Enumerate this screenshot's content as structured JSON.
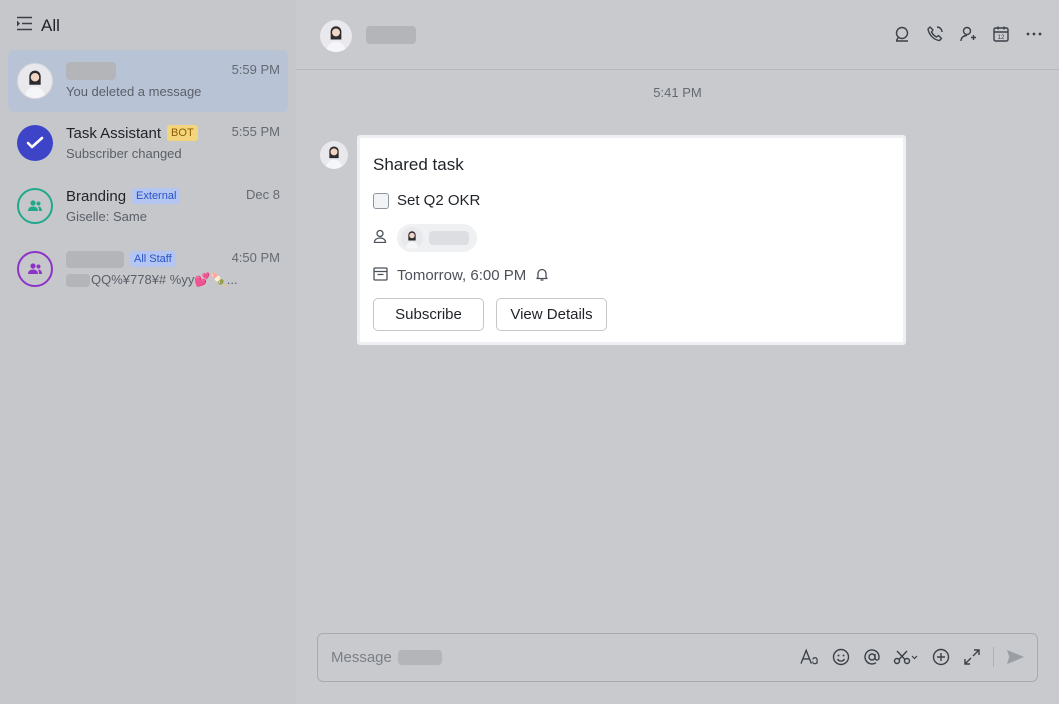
{
  "sidebar": {
    "title": "All",
    "chats": [
      {
        "name": "",
        "time": "5:59 PM",
        "preview": "You deleted a message",
        "tag": "",
        "active": true
      },
      {
        "name": "Task Assistant",
        "time": "5:55 PM",
        "preview": "Subscriber changed",
        "tag": "BOT"
      },
      {
        "name": "Branding",
        "time": "Dec 8",
        "preview": "Giselle: Same",
        "tag": "External"
      },
      {
        "name": "",
        "time": "4:50 PM",
        "preview": "QQ%¥778¥# %yy💕🍡...",
        "tag": "All Staff"
      }
    ]
  },
  "chat": {
    "header_name": "",
    "timestamp": "5:41 PM",
    "card": {
      "title": "Shared task",
      "task": "Set Q2 OKR",
      "due": "Tomorrow, 6:00 PM",
      "subscribe_label": "Subscribe",
      "view_label": "View Details"
    },
    "composer": {
      "placeholder": "Message"
    }
  },
  "colors": {
    "accent_blue": "#3d44c8",
    "group_green": "#1fa98a",
    "group_purple": "#8d33c8",
    "bot_tag": "#f4d57d",
    "external_tag": "#b4c5f2"
  },
  "icons": {
    "header": [
      "search-icon",
      "call-icon",
      "add-member-icon",
      "calendar-icon",
      "more-icon"
    ],
    "composer": [
      "font-format-icon",
      "emoji-icon",
      "mention-icon",
      "scissors-icon",
      "add-icon",
      "expand-icon",
      "send-icon"
    ]
  }
}
